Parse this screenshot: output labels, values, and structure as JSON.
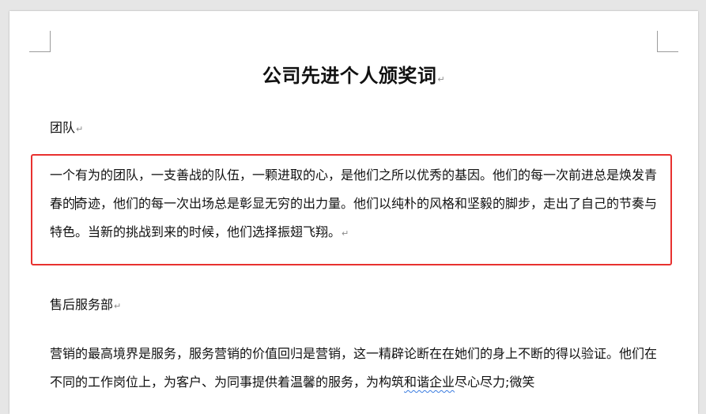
{
  "document": {
    "title": "公司先进个人颁奖词",
    "paragraph_mark": "↵",
    "sections": [
      {
        "heading": "团队",
        "text_before_cursor": "一个有为的团队，一支善战的队伍，一颗进取的心，是他们之所以优秀的基因。他们的每一次前进总是焕发青春的",
        "text_after_cursor": "奇迹，他们的每一次出场总是彰显无穷的出力量。他们以纯朴的风格和坚毅的脚步，走出了自己的节奏与特色。当新的挑战到来的时候，他们选择振翅飞翔。"
      },
      {
        "heading": "售后服务部",
        "text_main": "营销的最高境界是服务，服务营销的价值回归是营销，这一精辟论断在在她们的身上不断的得以验证。他们在不同的工作岗位上，为客户、为同事提供着温馨的服务，为构筑",
        "text_squiggle": "和谐企业",
        "text_tail": "尽心尽力;微笑"
      }
    ]
  },
  "colors": {
    "highlight_border": "#e8312f",
    "spellcheck_underline": "#3b7de0"
  }
}
